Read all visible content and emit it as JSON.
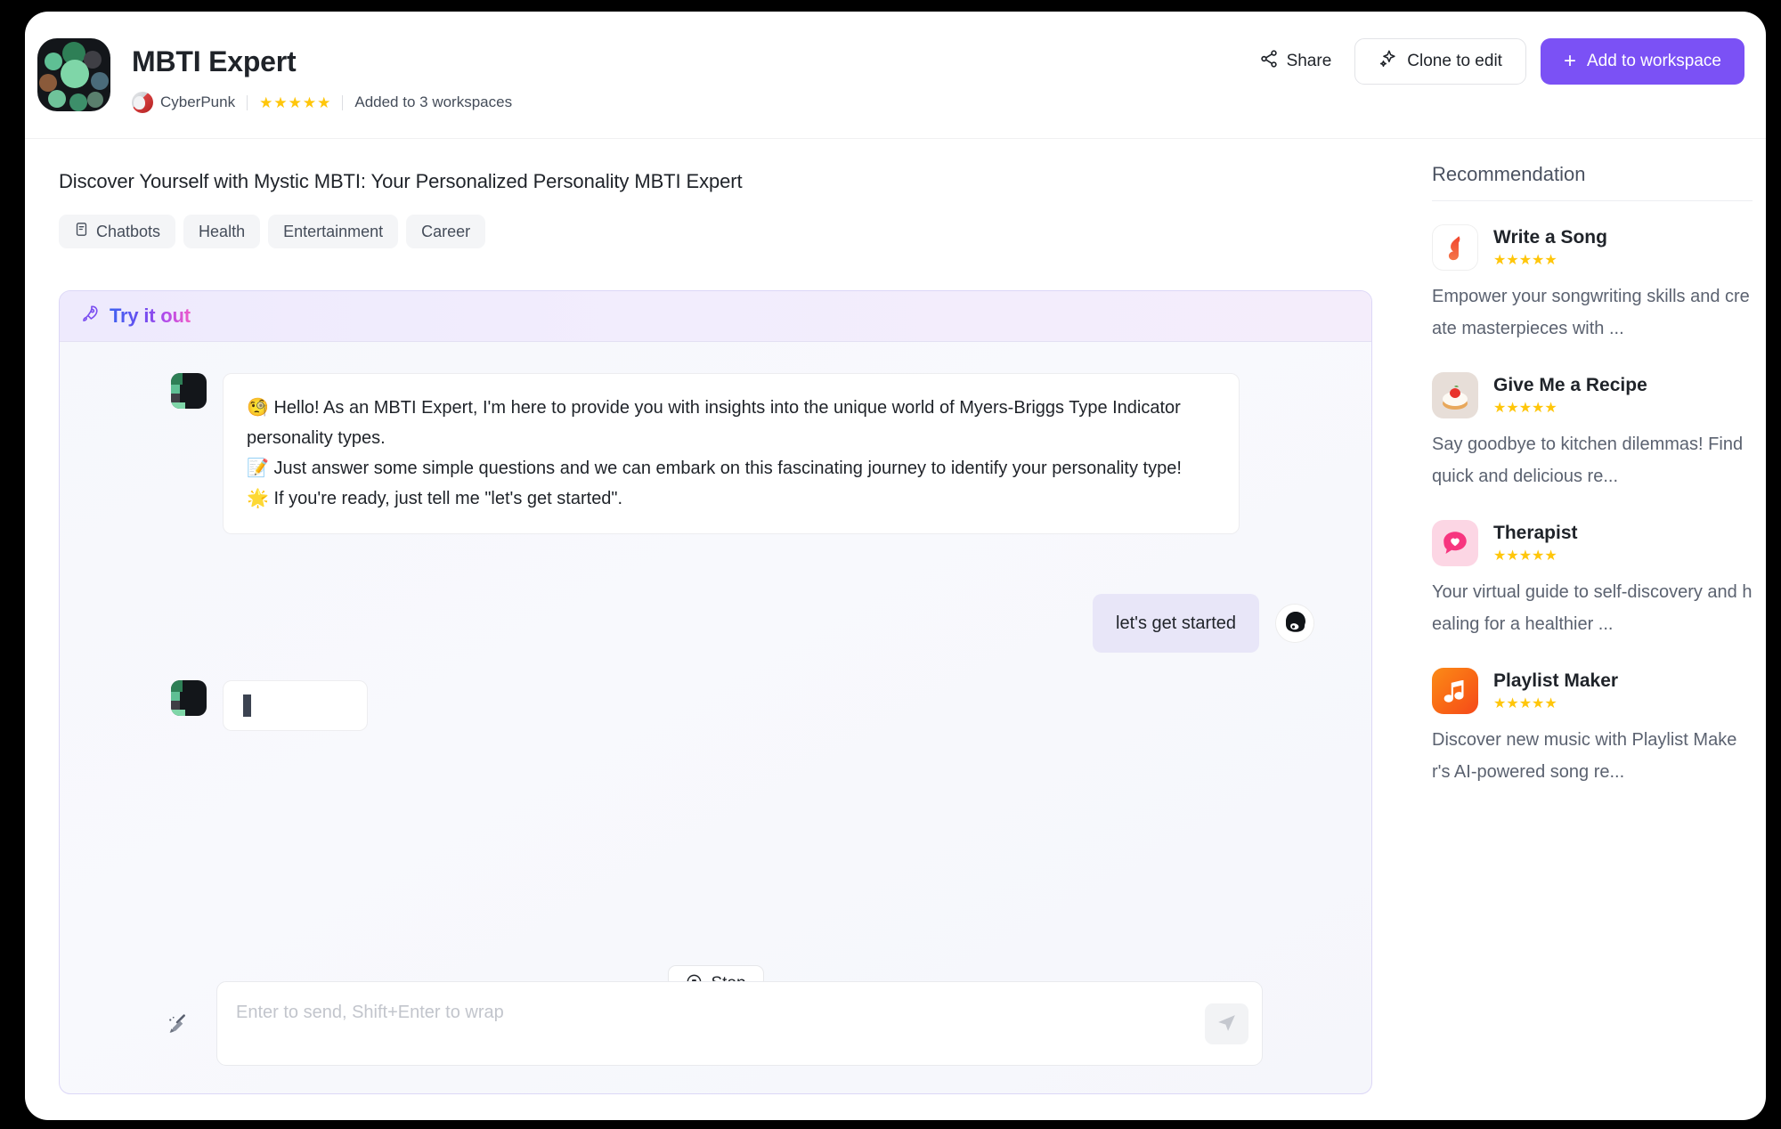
{
  "header": {
    "app_title": "MBTI Expert",
    "author": "CyberPunk",
    "rating_stars": 5,
    "workspaces_text": "Added to 3 workspaces",
    "share_label": "Share",
    "clone_label": "Clone to edit",
    "add_workspace_label": "Add to workspace",
    "plus_glyph": "+"
  },
  "description": "Discover Yourself with Mystic MBTI: Your Personalized Personality MBTI Expert",
  "tags": [
    {
      "label": "Chatbots",
      "icon": "document-icon"
    },
    {
      "label": "Health",
      "icon": ""
    },
    {
      "label": "Entertainment",
      "icon": ""
    },
    {
      "label": "Career",
      "icon": ""
    }
  ],
  "try_it_out": {
    "title_part1": "Try it",
    "title_part2": " out",
    "icon": "rocket-icon"
  },
  "chat": {
    "bot_message_lines": [
      "🧐 Hello! As an MBTI Expert, I'm here to provide you with insights into the unique world of Myers-Briggs Type Indicator personality types.",
      "📝 Just answer some simple questions and we can embark on this fascinating journey to identify your personality type!",
      "🌟 If you're ready, just tell me \"let's get started\"."
    ],
    "user_message": "let's get started",
    "typing_placeholder": "",
    "stop_label": "Stop",
    "input_placeholder": "Enter to send, Shift+Enter to wrap",
    "input_value": "",
    "clear_icon": "broom-icon",
    "send_icon": "send-icon"
  },
  "recommendation": {
    "title": "Recommendation",
    "items": [
      {
        "name": "Write a Song",
        "stars": 5,
        "description": "Empower your songwriting skills and create masterpieces with ...",
        "icon": "music-note-icon",
        "icon_bg": "#ffffff",
        "icon_color": "#f0483e"
      },
      {
        "name": "Give Me a Recipe",
        "stars": 5,
        "description": "Say goodbye to kitchen dilemmas! Find quick and delicious re...",
        "icon": "cake-icon",
        "icon_bg": "#efe6df",
        "icon_color": "#e23b3b"
      },
      {
        "name": "Therapist",
        "stars": 5,
        "description": "Your virtual guide to self-discovery and healing for a healthier ...",
        "icon": "heart-chat-icon",
        "icon_bg": "#fcd9e6",
        "icon_color": "#f7357f"
      },
      {
        "name": "Playlist Maker",
        "stars": 5,
        "description": "Discover new music with Playlist Maker's AI-powered song re...",
        "icon": "music-icon",
        "icon_bg": "#f98010",
        "icon_color": "#ffffff"
      }
    ]
  },
  "colors": {
    "accent": "#7B51F5",
    "star": "#FFC60A",
    "text": "#1f2329"
  }
}
